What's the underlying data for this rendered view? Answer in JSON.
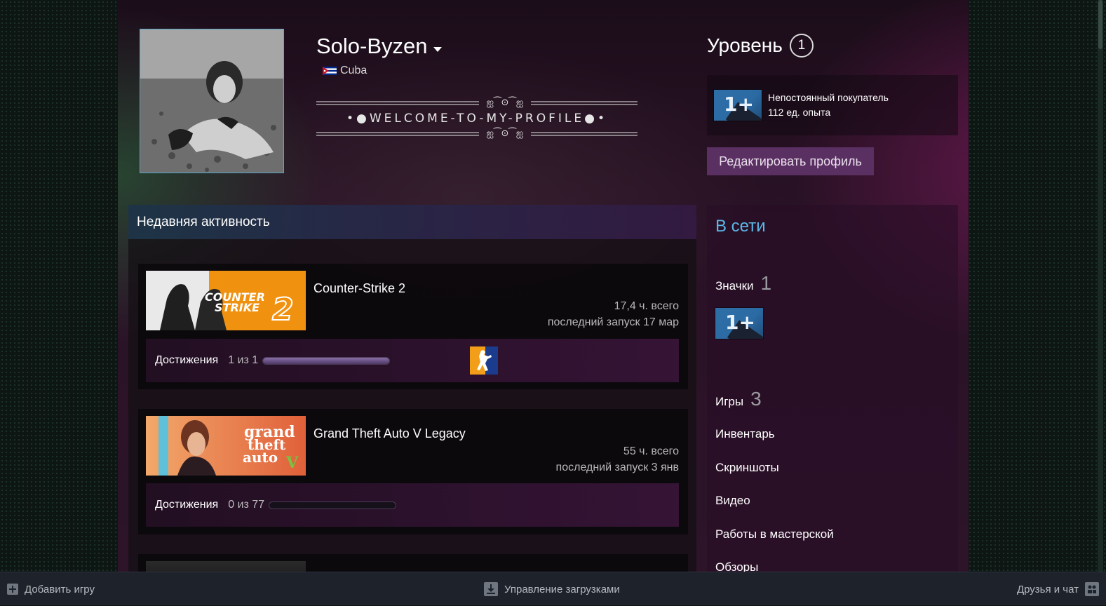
{
  "profile": {
    "name": "Solo-Byzen",
    "country": "Cuba",
    "summary": "•●WELCOME-TO-MY-PROFILE●•",
    "banner_ornament": "ஐ⁀⊙⁀ஐ"
  },
  "level": {
    "title": "Уровень",
    "value": "1",
    "badge_text": "1+",
    "badge_name": "Непостоянный покупатель",
    "xp": "112 ед. опыта"
  },
  "edit_button": "Редактировать профиль",
  "activity": {
    "title": "Недавняя активность",
    "games": [
      {
        "name": "Counter-Strike 2",
        "hours": "17,4 ч. всего",
        "last_played": "последний запуск 17 мар",
        "ach_label": "Достижения",
        "ach_count": "1 из 1",
        "ach_progress": 1.0,
        "img_text": "COUNTER STRIKE 2"
      },
      {
        "name": "Grand Theft Auto V Legacy",
        "hours": "55 ч. всего",
        "last_played": "последний запуск 3 янв",
        "ach_label": "Достижения",
        "ach_count": "0 из 77",
        "ach_progress": 0.0,
        "img_text": "grand theft auto V"
      }
    ]
  },
  "sidebar": {
    "status": "В сети",
    "badges_label": "Значки",
    "badges_count": "1",
    "badge_text": "1+",
    "games_label": "Игры",
    "games_count": "3",
    "links": [
      "Инвентарь",
      "Скриншоты",
      "Видео",
      "Работы в мастерской",
      "Обзоры"
    ]
  },
  "bottombar": {
    "add_game": "Добавить игру",
    "downloads": "Управление загрузками",
    "friends": "Друзья и чат"
  },
  "colors": {
    "accent_blue": "#5bb8e8",
    "edit_button_bg": "#5a2f62",
    "bottombar_bg": "#1d222b"
  }
}
